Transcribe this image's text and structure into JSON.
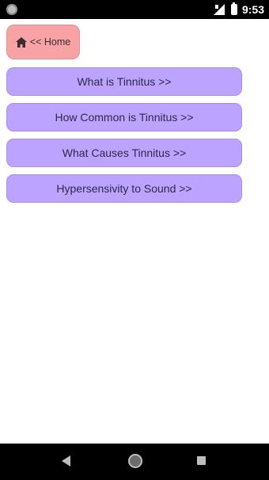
{
  "status_bar": {
    "time": "9:53",
    "icons": [
      "notification-icon",
      "signal-icon",
      "battery-icon"
    ]
  },
  "home_button": {
    "label": "<< Home",
    "icon": "home-icon"
  },
  "nav_buttons": [
    {
      "label": "What is Tinnitus >>"
    },
    {
      "label": "How Common is Tinnitus >>"
    },
    {
      "label": "What Causes Tinnitus >>"
    },
    {
      "label": "Hypersensivity to Sound >>"
    }
  ],
  "navigation_bar": {
    "icons": [
      "back-icon",
      "home-circle-icon",
      "recents-icon"
    ]
  },
  "colors": {
    "home_button": "#f9a2a5",
    "nav_button": "#bba3ff",
    "system_bars": "#000000"
  }
}
